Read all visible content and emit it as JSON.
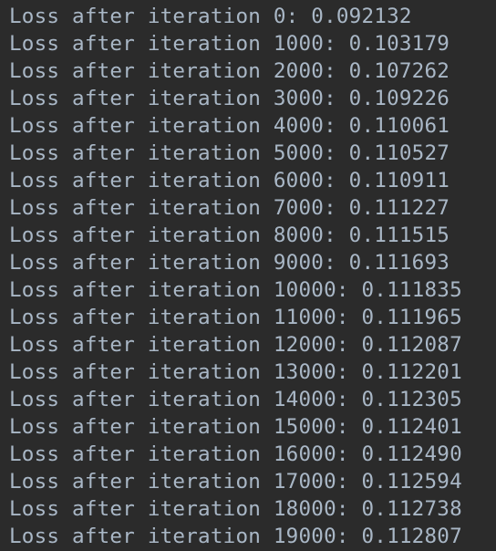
{
  "console": {
    "lines": [
      "Loss after iteration 0: 0.092132",
      "Loss after iteration 1000: 0.103179",
      "Loss after iteration 2000: 0.107262",
      "Loss after iteration 3000: 0.109226",
      "Loss after iteration 4000: 0.110061",
      "Loss after iteration 5000: 0.110527",
      "Loss after iteration 6000: 0.110911",
      "Loss after iteration 7000: 0.111227",
      "Loss after iteration 8000: 0.111515",
      "Loss after iteration 9000: 0.111693",
      "Loss after iteration 10000: 0.111835",
      "Loss after iteration 11000: 0.111965",
      "Loss after iteration 12000: 0.112087",
      "Loss after iteration 13000: 0.112201",
      "Loss after iteration 14000: 0.112305",
      "Loss after iteration 15000: 0.112401",
      "Loss after iteration 16000: 0.112490",
      "Loss after iteration 17000: 0.112594",
      "Loss after iteration 18000: 0.112738",
      "Loss after iteration 19000: 0.112807"
    ]
  },
  "colors": {
    "background": "#2b2b2b",
    "text": "#a9b7c6"
  }
}
